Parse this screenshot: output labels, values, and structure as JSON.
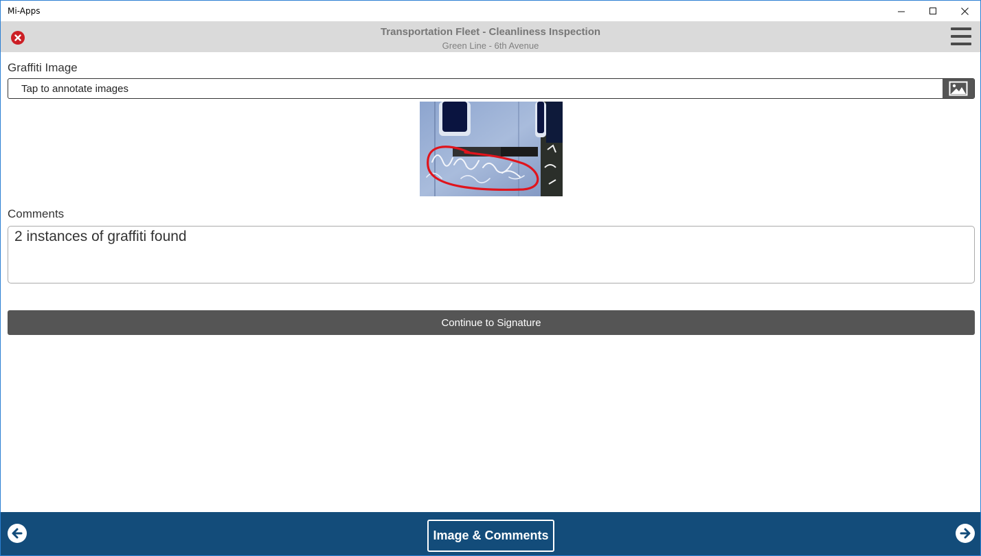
{
  "window": {
    "title": "Mi-Apps",
    "controls": [
      "minimize-icon",
      "maximize-icon",
      "close-icon"
    ]
  },
  "header": {
    "title": "Transportation Fleet - Cleanliness Inspection",
    "subtitle": "Green Line - 6th Avenue",
    "close_icon": "close-circle-icon",
    "menu_icon": "hamburger-menu-icon"
  },
  "form": {
    "graffiti_label": "Graffiti Image",
    "annotate_placeholder": "Tap to annotate images",
    "annotate_icon": "image-icon",
    "comments_label": "Comments",
    "comments_value": "2 instances of graffiti found",
    "continue_label": "Continue to Signature"
  },
  "footer": {
    "section_label": "Image & Comments",
    "prev_icon": "arrow-left-circle-icon",
    "next_icon": "arrow-right-circle-icon"
  },
  "colors": {
    "header_bg": "#dadada",
    "button_bg": "#555555",
    "footer_bg": "#134c7a",
    "close_red": "#cc1f25",
    "annotation_red": "#e0141c"
  }
}
